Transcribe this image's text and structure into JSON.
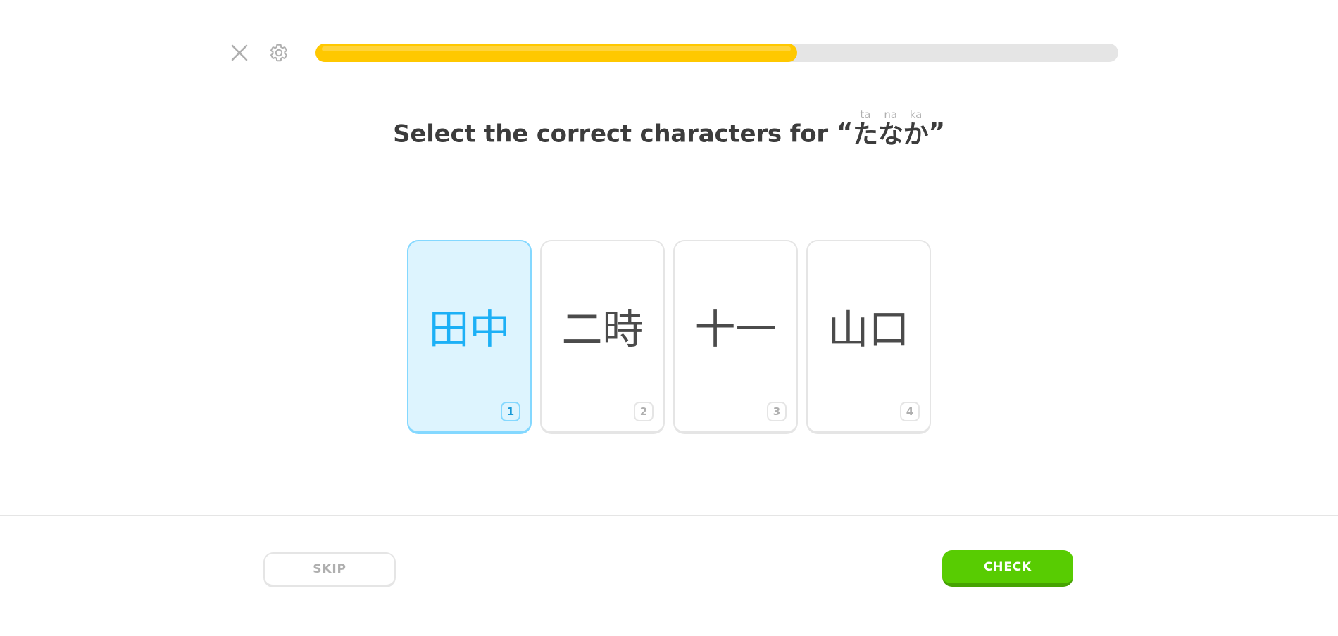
{
  "header": {
    "close_icon": "close-icon",
    "settings_icon": "gear-icon",
    "progress": {
      "percent": 60,
      "fill_color": "#ffc800",
      "track_color": "#e5e5e5"
    }
  },
  "prompt": {
    "lead_text": "Select the correct characters for ",
    "open_quote": "“",
    "close_quote": "”",
    "ruby": [
      {
        "base": "た",
        "reading": "ta"
      },
      {
        "base": "な",
        "reading": "na"
      },
      {
        "base": "か",
        "reading": "ka"
      }
    ]
  },
  "choices": {
    "cards": [
      {
        "glyph": "田中",
        "index": "1",
        "selected": true
      },
      {
        "glyph": "二時",
        "index": "2",
        "selected": false
      },
      {
        "glyph": "十一",
        "index": "3",
        "selected": false
      },
      {
        "glyph": "山口",
        "index": "4",
        "selected": false
      }
    ]
  },
  "footer": {
    "skip_label": "SKIP",
    "check_label": "CHECK",
    "check_color": "#58cc02"
  }
}
